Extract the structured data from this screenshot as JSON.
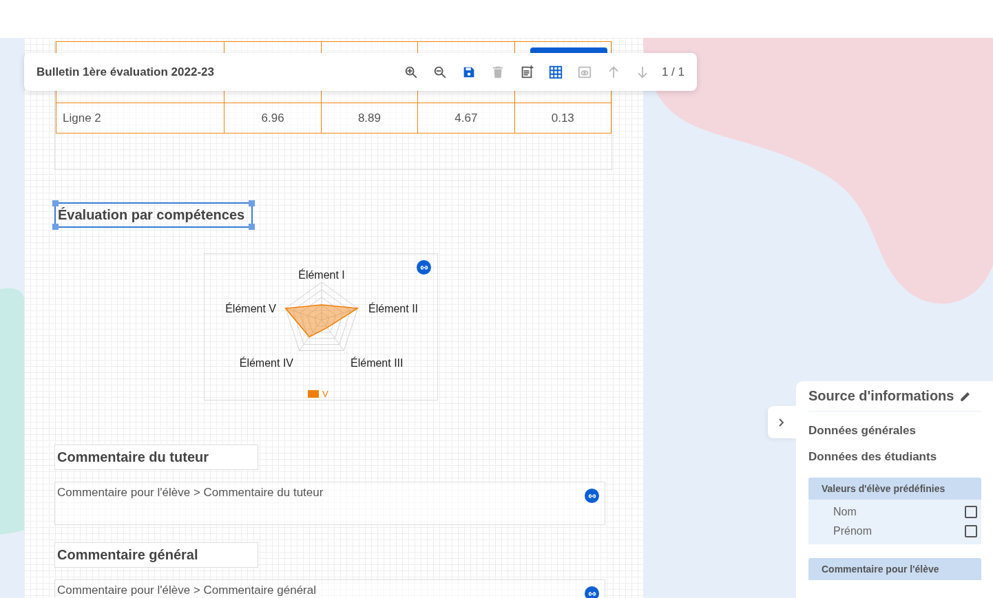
{
  "toolbar": {
    "title": "Bulletin 1ère évaluation 2022-23",
    "tools": [
      {
        "kind": "zoom-in",
        "disabled": false,
        "highlighted": false
      },
      {
        "kind": "zoom-out",
        "disabled": false,
        "highlighted": false
      },
      {
        "kind": "save",
        "disabled": false,
        "highlighted": true
      },
      {
        "kind": "delete",
        "disabled": true,
        "highlighted": false
      },
      {
        "kind": "add-note",
        "disabled": false,
        "highlighted": false
      },
      {
        "kind": "grid",
        "disabled": false,
        "highlighted": true
      },
      {
        "kind": "preview",
        "disabled": true,
        "highlighted": false
      },
      {
        "kind": "up",
        "disabled": true,
        "highlighted": false
      },
      {
        "kind": "down",
        "disabled": true,
        "highlighted": false
      }
    ],
    "page_counter": "1 / 1"
  },
  "table": {
    "rows": [
      {
        "cells": [
          "",
          "",
          "",
          "",
          ""
        ],
        "button": true
      },
      {
        "cells": [
          "Ligne 2",
          "6.96",
          "8.89",
          "4.67",
          "0.13"
        ],
        "button": false
      }
    ]
  },
  "section_title": {
    "text": "Évaluation par compétences",
    "selected": true
  },
  "radar": {
    "axes": [
      "Élément I",
      "Élément II",
      "Élément III",
      "Élément IV",
      "Élément V"
    ],
    "legend": "V",
    "color": "#f07f09"
  },
  "comments": [
    {
      "title": "Commentaire du tuteur",
      "field": "Commentaire pour l'élève > Commentaire du tuteur"
    },
    {
      "title": "Commentaire général",
      "field": "Commentaire pour l'élève > Commentaire général"
    }
  ],
  "panel": {
    "title": "Source d'informations",
    "links": [
      "Données générales",
      "Données des étudiants"
    ],
    "groups": [
      {
        "title": "Valeurs d'élève prédéfinies",
        "items": [
          {
            "label": "Nom",
            "checked": false
          },
          {
            "label": "Prénom",
            "checked": false
          }
        ]
      },
      {
        "title": "Commentaire pour l'élève"
      }
    ]
  }
}
